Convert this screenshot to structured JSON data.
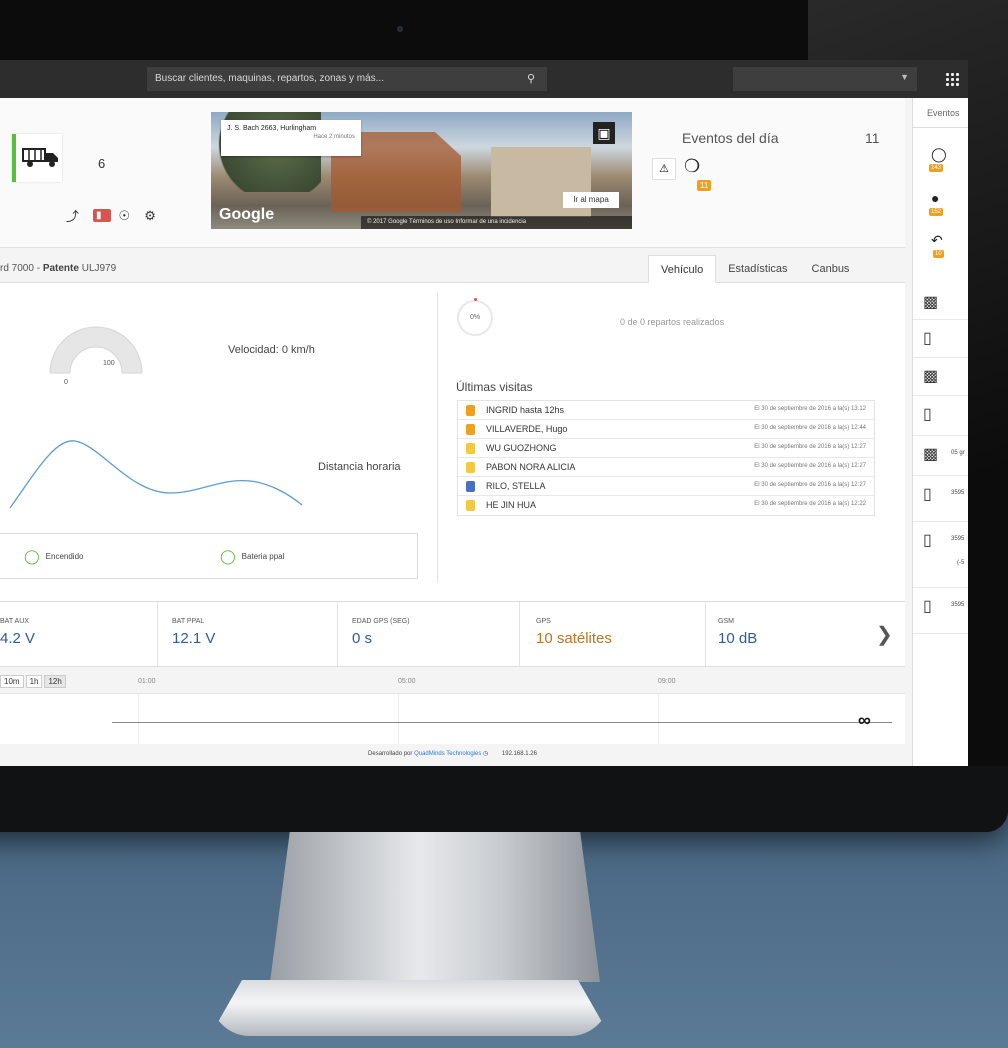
{
  "topbar": {
    "search_placeholder": "Buscar clientes, maquinas, repartos, zonas y más...",
    "search_icon": "search-icon",
    "apps_icon": "grid-icon"
  },
  "unit": {
    "count": "6"
  },
  "streetview": {
    "address": "J. S. Bach 2663, Hurlingham",
    "updated": "Hace 2 minutos",
    "goto_map": "Ir al mapa",
    "logo": "Google",
    "footer": "© 2017 Google   Términos de uso   Informar de una incidencia"
  },
  "events": {
    "title": "Eventos del día",
    "count": "11",
    "badge": "11"
  },
  "side_panel": {
    "tab": "Eventos",
    "badges": [
      "143",
      "152",
      "10"
    ],
    "rows": [
      "",
      "",
      "",
      "",
      "05 gr",
      "3595",
      "3595",
      "(-5",
      "3595"
    ]
  },
  "vehicle": {
    "title_prefix": "rd 7000 - ",
    "title_bold": "Patente",
    "title_suffix": " ULJ979",
    "tabs": [
      "Vehículo",
      "Estadísticas",
      "Canbus"
    ]
  },
  "gauge": {
    "min": "0",
    "max": "100",
    "value": 0
  },
  "velocity": "Velocidad: 0 km/h",
  "distance_label": "Distancia horaria",
  "status": [
    {
      "label": "Encendido"
    },
    {
      "label": "Bateria ppal"
    }
  ],
  "deliveries": {
    "percent": "0%",
    "text": "0 de 0 repartos realizados"
  },
  "visits": {
    "title": "Últimas visitas",
    "rows": [
      {
        "name": "INGRID hasta 12hs",
        "date": "El 30 de septiembre de 2016 a la(s) 13:12",
        "color": "#f0a020"
      },
      {
        "name": "VILLAVERDE, Hugo",
        "date": "El 30 de septiembre de 2016 a la(s) 12:44",
        "color": "#f0a020"
      },
      {
        "name": "WU GUOZHONG",
        "date": "El 30 de septiembre de 2016 a la(s) 12:27",
        "color": "#f5c842"
      },
      {
        "name": "PABON NORA ALICIA",
        "date": "El 30 de septiembre de 2016 a la(s) 12:27",
        "color": "#f5c842"
      },
      {
        "name": "RILO, STELLA",
        "date": "El 30 de septiembre de 2016 a la(s) 12:27",
        "color": "#4a6fc1"
      },
      {
        "name": "HE JIN HUA",
        "date": "El 30 de septiembre de 2016 a la(s) 12:22",
        "color": "#f5c842"
      }
    ]
  },
  "metrics": [
    {
      "label": "BAT AUX",
      "value": "4.2 V"
    },
    {
      "label": "BAT PPAL",
      "value": "12.1 V"
    },
    {
      "label": "EDAD GPS (SEG)",
      "value": "0 s"
    },
    {
      "label": "GPS",
      "value": "10 satélites"
    },
    {
      "label": "GSM",
      "value": "10 dB"
    }
  ],
  "timeline": {
    "zoom": [
      "10m",
      "1h",
      "12h"
    ],
    "ticks": [
      "01:00",
      "05:00",
      "09:00"
    ]
  },
  "footer": {
    "prefix": "Desarrollado por ",
    "company": "QuadMinds Technologies",
    "ip": "192.168.1.26"
  },
  "colors": {
    "accent_green": "#5bbd3c",
    "badge_orange": "#f0a020",
    "metric_blue": "#2c5c9a",
    "gps_orange": "#c07320"
  }
}
